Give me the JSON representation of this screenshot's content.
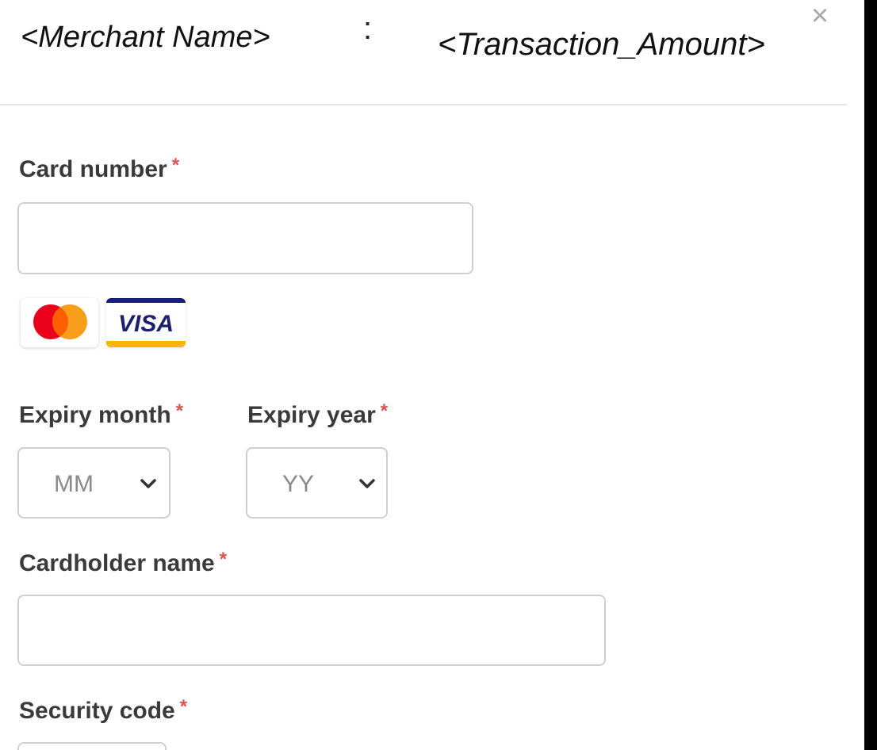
{
  "header": {
    "merchant_name": "<Merchant Name>",
    "separator": ":",
    "transaction_amount": "<Transaction_Amount>",
    "close_symbol": "×"
  },
  "form": {
    "card_number": {
      "label": "Card number",
      "required_mark": "*",
      "value": "",
      "placeholder": ""
    },
    "card_brands": [
      {
        "name": "mastercard",
        "icon": "mastercard-logo-icon"
      },
      {
        "name": "visa",
        "icon": "visa-logo-icon",
        "text": "VISA"
      }
    ],
    "expiry_month": {
      "label": "Expiry month",
      "required_mark": "*",
      "selected": "MM"
    },
    "expiry_year": {
      "label": "Expiry year",
      "required_mark": "*",
      "selected": "YY"
    },
    "cardholder_name": {
      "label": "Cardholder name",
      "required_mark": "*",
      "value": "",
      "placeholder": ""
    },
    "security_code": {
      "label": "Security code",
      "required_mark": "*"
    }
  },
  "colors": {
    "required": "#d9534f",
    "label": "#3a3a3a",
    "border": "#cfcfcf",
    "visa_blue": "#1a1f71",
    "visa_gold": "#f7b600",
    "mc_red": "#eb001b",
    "mc_orange": "#f79e1b"
  }
}
